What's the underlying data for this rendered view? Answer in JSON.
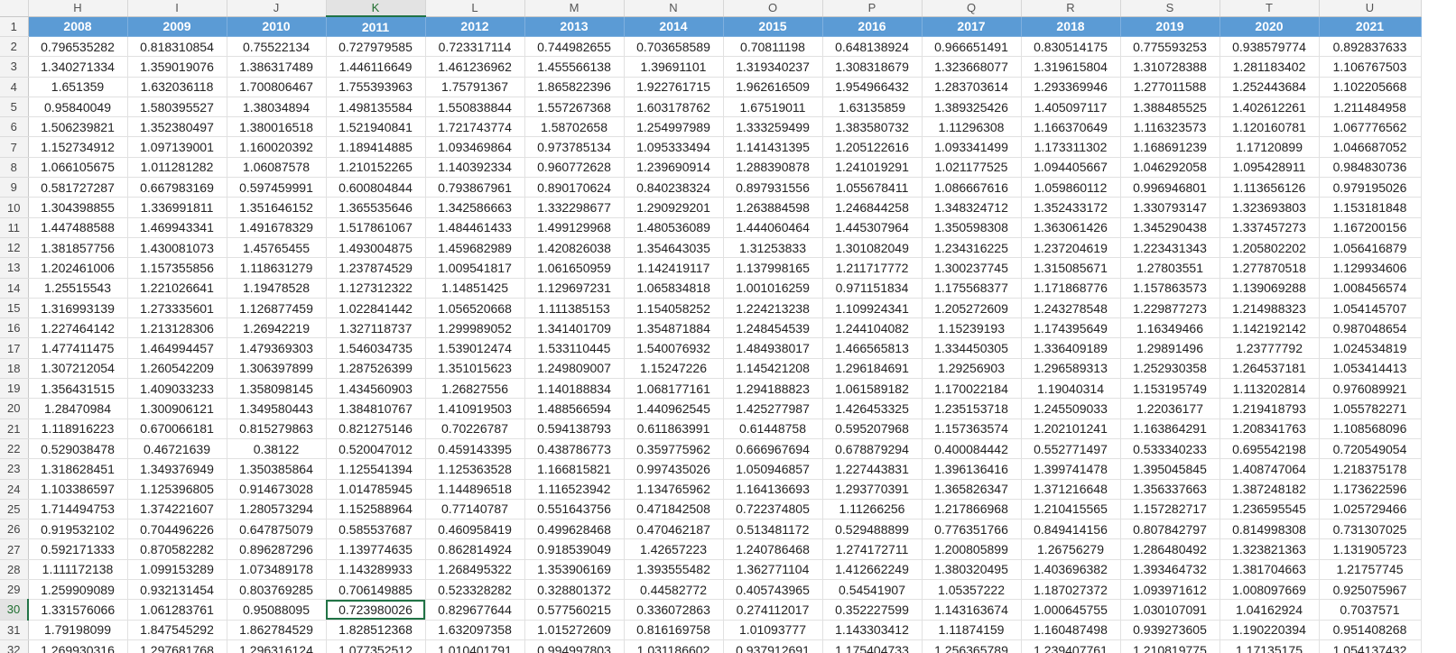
{
  "sheet": {
    "columns": [
      "H",
      "I",
      "J",
      "K",
      "L",
      "M",
      "N",
      "O",
      "P",
      "Q",
      "R",
      "S",
      "T",
      "U"
    ],
    "active_column": "K",
    "active_row": 30,
    "header_row_number": 1,
    "years": [
      "2008",
      "2009",
      "2010",
      "2011",
      "2012",
      "2013",
      "2014",
      "2015",
      "2016",
      "2017",
      "2018",
      "2019",
      "2020",
      "2021"
    ],
    "rows": [
      {
        "num": 2,
        "values": [
          "0.796535282",
          "0.818310854",
          "0.75522134",
          "0.727979585",
          "0.723317114",
          "0.744982655",
          "0.703658589",
          "0.70811198",
          "0.648138924",
          "0.966651491",
          "0.830514175",
          "0.775593253",
          "0.938579774",
          "0.892837633"
        ]
      },
      {
        "num": 3,
        "values": [
          "1.340271334",
          "1.359019076",
          "1.386317489",
          "1.446116649",
          "1.461236962",
          "1.455566138",
          "1.39691101",
          "1.319340237",
          "1.308318679",
          "1.323668077",
          "1.319615804",
          "1.310728388",
          "1.281183402",
          "1.106767503"
        ]
      },
      {
        "num": 4,
        "values": [
          "1.651359",
          "1.632036118",
          "1.700806467",
          "1.755393963",
          "1.75791367",
          "1.865822396",
          "1.922761715",
          "1.962616509",
          "1.954966432",
          "1.283703614",
          "1.293369946",
          "1.277011588",
          "1.252443684",
          "1.102205668"
        ]
      },
      {
        "num": 5,
        "values": [
          "0.95840049",
          "1.580395527",
          "1.38034894",
          "1.498135584",
          "1.550838844",
          "1.557267368",
          "1.603178762",
          "1.67519011",
          "1.63135859",
          "1.389325426",
          "1.405097117",
          "1.388485525",
          "1.402612261",
          "1.211484958"
        ]
      },
      {
        "num": 6,
        "values": [
          "1.506239821",
          "1.352380497",
          "1.380016518",
          "1.521940841",
          "1.721743774",
          "1.58702658",
          "1.254997989",
          "1.333259499",
          "1.383580732",
          "1.11296308",
          "1.166370649",
          "1.116323573",
          "1.120160781",
          "1.067776562"
        ]
      },
      {
        "num": 7,
        "values": [
          "1.152734912",
          "1.097139001",
          "1.160020392",
          "1.189414885",
          "1.093469864",
          "0.973785134",
          "1.095333494",
          "1.141431395",
          "1.205122616",
          "1.093341499",
          "1.173311302",
          "1.168691239",
          "1.17120899",
          "1.046687052"
        ]
      },
      {
        "num": 8,
        "values": [
          "1.066105675",
          "1.011281282",
          "1.06087578",
          "1.210152265",
          "1.140392334",
          "0.960772628",
          "1.239690914",
          "1.288390878",
          "1.241019291",
          "1.021177525",
          "1.094405667",
          "1.046292058",
          "1.095428911",
          "0.984830736"
        ]
      },
      {
        "num": 9,
        "values": [
          "0.581727287",
          "0.667983169",
          "0.597459991",
          "0.600804844",
          "0.793867961",
          "0.890170624",
          "0.840238324",
          "0.897931556",
          "1.055678411",
          "1.086667616",
          "1.059860112",
          "0.996946801",
          "1.113656126",
          "0.979195026"
        ]
      },
      {
        "num": 10,
        "values": [
          "1.304398855",
          "1.336991811",
          "1.351646152",
          "1.365535646",
          "1.342586663",
          "1.332298677",
          "1.290929201",
          "1.263884598",
          "1.246844258",
          "1.348324712",
          "1.352433172",
          "1.330793147",
          "1.323693803",
          "1.153181848"
        ]
      },
      {
        "num": 11,
        "values": [
          "1.447488588",
          "1.469943341",
          "1.491678329",
          "1.517861067",
          "1.484461433",
          "1.499129968",
          "1.480536089",
          "1.444060464",
          "1.445307964",
          "1.350598308",
          "1.363061426",
          "1.345290438",
          "1.337457273",
          "1.167200156"
        ]
      },
      {
        "num": 12,
        "values": [
          "1.381857756",
          "1.430081073",
          "1.45765455",
          "1.493004875",
          "1.459682989",
          "1.420826038",
          "1.354643035",
          "1.31253833",
          "1.301082049",
          "1.234316225",
          "1.237204619",
          "1.223431343",
          "1.205802202",
          "1.056416879"
        ]
      },
      {
        "num": 13,
        "values": [
          "1.202461006",
          "1.157355856",
          "1.118631279",
          "1.237874529",
          "1.009541817",
          "1.061650959",
          "1.142419117",
          "1.137998165",
          "1.211717772",
          "1.300237745",
          "1.315085671",
          "1.27803551",
          "1.277870518",
          "1.129934606"
        ]
      },
      {
        "num": 14,
        "values": [
          "1.25515543",
          "1.221026641",
          "1.19478528",
          "1.127312322",
          "1.14851425",
          "1.129697231",
          "1.065834818",
          "1.001016259",
          "0.971151834",
          "1.175568377",
          "1.171868776",
          "1.157863573",
          "1.139069288",
          "1.008456574"
        ]
      },
      {
        "num": 15,
        "values": [
          "1.316993139",
          "1.273335601",
          "1.126877459",
          "1.022841442",
          "1.056520668",
          "1.111385153",
          "1.154058252",
          "1.224213238",
          "1.109924341",
          "1.205272609",
          "1.243278548",
          "1.229877273",
          "1.214988323",
          "1.054145707"
        ]
      },
      {
        "num": 16,
        "values": [
          "1.227464142",
          "1.213128306",
          "1.26942219",
          "1.327118737",
          "1.299989052",
          "1.341401709",
          "1.354871884",
          "1.248454539",
          "1.244104082",
          "1.15239193",
          "1.174395649",
          "1.16349466",
          "1.142192142",
          "0.987048654"
        ]
      },
      {
        "num": 17,
        "values": [
          "1.477411475",
          "1.464994457",
          "1.479369303",
          "1.546034735",
          "1.539012474",
          "1.533110445",
          "1.540076932",
          "1.484938017",
          "1.466565813",
          "1.334450305",
          "1.336409189",
          "1.29891496",
          "1.23777792",
          "1.024534819"
        ]
      },
      {
        "num": 18,
        "values": [
          "1.307212054",
          "1.260542209",
          "1.306397899",
          "1.287526399",
          "1.351015623",
          "1.249809007",
          "1.15247226",
          "1.145421208",
          "1.296184691",
          "1.29256903",
          "1.296589313",
          "1.252930358",
          "1.264537181",
          "1.053414413"
        ]
      },
      {
        "num": 19,
        "values": [
          "1.356431515",
          "1.409033233",
          "1.358098145",
          "1.434560903",
          "1.26827556",
          "1.140188834",
          "1.068177161",
          "1.294188823",
          "1.061589182",
          "1.170022184",
          "1.19040314",
          "1.153195749",
          "1.113202814",
          "0.976089921"
        ]
      },
      {
        "num": 20,
        "values": [
          "1.28470984",
          "1.300906121",
          "1.349580443",
          "1.384810767",
          "1.410919503",
          "1.488566594",
          "1.440962545",
          "1.425277987",
          "1.426453325",
          "1.235153718",
          "1.245509033",
          "1.22036177",
          "1.219418793",
          "1.055782271"
        ]
      },
      {
        "num": 21,
        "values": [
          "1.118916223",
          "0.670066181",
          "0.815279863",
          "0.821275146",
          "0.70226787",
          "0.594138793",
          "0.611863991",
          "0.61448758",
          "0.595207968",
          "1.157363574",
          "1.202101241",
          "1.163864291",
          "1.208341763",
          "1.108568096"
        ]
      },
      {
        "num": 22,
        "values": [
          "0.529038478",
          "0.46721639",
          "0.38122",
          "0.520047012",
          "0.459143395",
          "0.438786773",
          "0.359775962",
          "0.666967694",
          "0.678879294",
          "0.400084442",
          "0.552771497",
          "0.533340233",
          "0.695542198",
          "0.720549054"
        ]
      },
      {
        "num": 23,
        "values": [
          "1.318628451",
          "1.349376949",
          "1.350385864",
          "1.125541394",
          "1.125363528",
          "1.166815821",
          "0.997435026",
          "1.050946857",
          "1.227443831",
          "1.396136416",
          "1.399741478",
          "1.395045845",
          "1.408747064",
          "1.218375178"
        ]
      },
      {
        "num": 24,
        "values": [
          "1.103386597",
          "1.125396805",
          "0.914673028",
          "1.014785945",
          "1.144896518",
          "1.116523942",
          "1.134765962",
          "1.164136693",
          "1.293770391",
          "1.365826347",
          "1.371216648",
          "1.356337663",
          "1.387248182",
          "1.173622596"
        ]
      },
      {
        "num": 25,
        "values": [
          "1.714494753",
          "1.374221607",
          "1.280573294",
          "1.152588964",
          "0.77140787",
          "0.551643756",
          "0.471842508",
          "0.722374805",
          "1.11266256",
          "1.217866968",
          "1.210415565",
          "1.157282717",
          "1.236595545",
          "1.025729466"
        ]
      },
      {
        "num": 26,
        "values": [
          "0.919532102",
          "0.704496226",
          "0.647875079",
          "0.585537687",
          "0.460958419",
          "0.499628468",
          "0.470462187",
          "0.513481172",
          "0.529488899",
          "0.776351766",
          "0.849414156",
          "0.807842797",
          "0.814998308",
          "0.731307025"
        ]
      },
      {
        "num": 27,
        "values": [
          "0.592171333",
          "0.870582282",
          "0.896287296",
          "1.139774635",
          "0.862814924",
          "0.918539049",
          "1.42657223",
          "1.240786468",
          "1.274172711",
          "1.200805899",
          "1.26756279",
          "1.286480492",
          "1.323821363",
          "1.131905723"
        ]
      },
      {
        "num": 28,
        "values": [
          "1.111172138",
          "1.099153289",
          "1.073489178",
          "1.143289933",
          "1.268495322",
          "1.353906169",
          "1.393555482",
          "1.362771104",
          "1.412662249",
          "1.380320495",
          "1.403696382",
          "1.393464732",
          "1.381704663",
          "1.21757745"
        ]
      },
      {
        "num": 29,
        "values": [
          "1.259909089",
          "0.932131454",
          "0.803769285",
          "0.706149885",
          "0.523328282",
          "0.328801372",
          "0.44582772",
          "0.405743965",
          "0.54541907",
          "1.05357222",
          "1.187027372",
          "1.093971612",
          "1.008097669",
          "0.925075967"
        ]
      },
      {
        "num": 30,
        "values": [
          "1.331576066",
          "1.061283761",
          "0.95088095",
          "0.723980026",
          "0.829677644",
          "0.577560215",
          "0.336072863",
          "0.274112017",
          "0.352227599",
          "1.143163674",
          "1.000645755",
          "1.030107091",
          "1.04162924",
          "0.7037571"
        ]
      },
      {
        "num": 31,
        "values": [
          "1.79198099",
          "1.847545292",
          "1.862784529",
          "1.828512368",
          "1.632097358",
          "1.015272609",
          "0.816169758",
          "1.01093777",
          "1.143303412",
          "1.11874159",
          "1.160487498",
          "0.939273605",
          "1.190220394",
          "0.951408268"
        ]
      },
      {
        "num": 32,
        "values": [
          "1.269930316",
          "1.297681768",
          "1.296316124",
          "1.077352512",
          "1.010401791",
          "0.994997803",
          "1.031186602",
          "0.937912691",
          "1.175404733",
          "1.256365789",
          "1.239407761",
          "1.210819775",
          "1.17135175",
          "1.054137432"
        ]
      }
    ]
  }
}
